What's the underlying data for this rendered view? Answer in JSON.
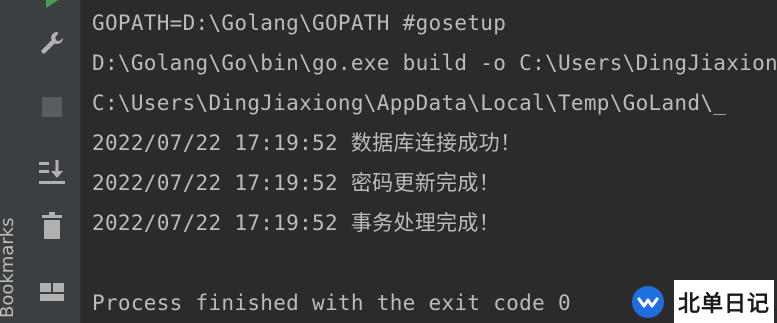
{
  "side_strip": {
    "label": "Bookmarks"
  },
  "toolbar": {
    "icons": [
      "run-icon",
      "wrench-icon",
      "stop-icon",
      "scroll-to-end-icon",
      "trash-icon",
      "layout-icon"
    ]
  },
  "console": {
    "lines": [
      "GOPATH=D:\\Golang\\GOPATH #gosetup",
      "D:\\Golang\\Go\\bin\\go.exe build -o C:\\Users\\DingJiaxiong\\AppData\\Local\\Temp\\GoLand\\",
      "C:\\Users\\DingJiaxiong\\AppData\\Local\\Temp\\GoLand\\_",
      "2022/07/22 17:19:52 数据库连接成功！",
      "2022/07/22 17:19:52 密码更新完成！",
      "2022/07/22 17:19:52 事务处理完成！",
      "",
      "Process finished with the exit code 0"
    ]
  },
  "watermark": {
    "text": "北单日记"
  },
  "colors": {
    "console_bg": "#2b2b2b",
    "toolbar_bg": "#3c3f41",
    "text": "#bbbbbb",
    "run_green": "#499c54",
    "icon_gray": "#afb1b3",
    "stop_disabled": "#5a5d5f",
    "watermark_blue": "#1f6fde"
  }
}
